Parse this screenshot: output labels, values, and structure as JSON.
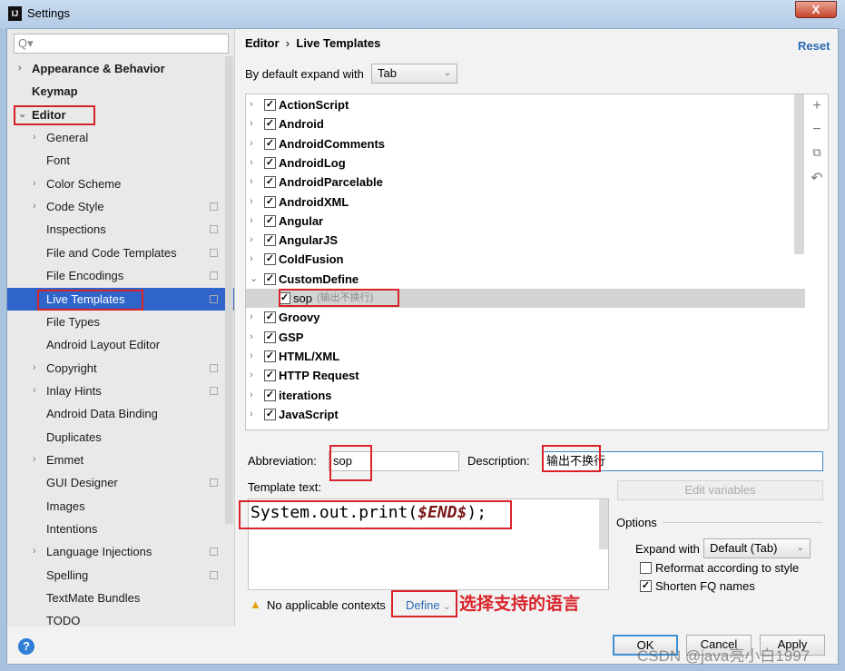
{
  "window": {
    "title": "Settings",
    "close_label": "X"
  },
  "sidebar": {
    "search_placeholder": "Q▾",
    "items": [
      {
        "label": "Appearance & Behavior",
        "level": 0,
        "arrow": true,
        "bold": true
      },
      {
        "label": "Keymap",
        "level": 0,
        "bold": true
      },
      {
        "label": "Editor",
        "level": 0,
        "arrow": "open",
        "bold": true
      },
      {
        "label": "General",
        "level": 1,
        "arrow": true
      },
      {
        "label": "Font",
        "level": 1
      },
      {
        "label": "Color Scheme",
        "level": 1,
        "arrow": true
      },
      {
        "label": "Code Style",
        "level": 1,
        "arrow": true,
        "copy": true
      },
      {
        "label": "Inspections",
        "level": 1,
        "copy": true
      },
      {
        "label": "File and Code Templates",
        "level": 1,
        "copy": true
      },
      {
        "label": "File Encodings",
        "level": 1,
        "copy": true
      },
      {
        "label": "Live Templates",
        "level": 1,
        "copy": true,
        "selected": true
      },
      {
        "label": "File Types",
        "level": 1
      },
      {
        "label": "Android Layout Editor",
        "level": 1
      },
      {
        "label": "Copyright",
        "level": 1,
        "arrow": true,
        "copy": true
      },
      {
        "label": "Inlay Hints",
        "level": 1,
        "arrow": true,
        "copy": true
      },
      {
        "label": "Android Data Binding",
        "level": 1
      },
      {
        "label": "Duplicates",
        "level": 1
      },
      {
        "label": "Emmet",
        "level": 1,
        "arrow": true
      },
      {
        "label": "GUI Designer",
        "level": 1,
        "copy": true
      },
      {
        "label": "Images",
        "level": 1
      },
      {
        "label": "Intentions",
        "level": 1
      },
      {
        "label": "Language Injections",
        "level": 1,
        "arrow": true,
        "copy": true
      },
      {
        "label": "Spelling",
        "level": 1,
        "copy": true
      },
      {
        "label": "TextMate Bundles",
        "level": 1
      },
      {
        "label": "TODO",
        "level": 1
      }
    ]
  },
  "header": {
    "crumb_parent": "Editor",
    "crumb_sep": "›",
    "crumb_current": "Live Templates",
    "reset": "Reset"
  },
  "expand": {
    "label": "By default expand with",
    "value": "Tab"
  },
  "tree": [
    {
      "label": "ActionScript"
    },
    {
      "label": "Android"
    },
    {
      "label": "AndroidComments"
    },
    {
      "label": "AndroidLog"
    },
    {
      "label": "AndroidParcelable"
    },
    {
      "label": "AndroidXML"
    },
    {
      "label": "Angular"
    },
    {
      "label": "AngularJS"
    },
    {
      "label": "ColdFusion"
    },
    {
      "label": "CustomDefine",
      "open": true
    },
    {
      "label": "sop",
      "desc": "(输出不换行)",
      "child": true,
      "selected": true
    },
    {
      "label": "Groovy"
    },
    {
      "label": "GSP"
    },
    {
      "label": "HTML/XML"
    },
    {
      "label": "HTTP Request"
    },
    {
      "label": "iterations"
    },
    {
      "label": "JavaScript"
    }
  ],
  "tools": [
    "+",
    "−",
    "⧉",
    "↶"
  ],
  "editor": {
    "abbreviation_label": "Abbreviation:",
    "abbreviation": "sop",
    "description_label": "Description:",
    "description": "输出不换行",
    "template_label": "Template text:",
    "template_pre": "System.out.print(",
    "template_var": "$END$",
    "template_post": ");",
    "edit_variables": "Edit variables",
    "options_label": "Options",
    "expand_with_label": "Expand with",
    "expand_with": "Default (Tab)",
    "reformat": "Reformat according to style",
    "reformat_checked": false,
    "shorten": "Shorten FQ names",
    "shorten_checked": true,
    "warning": "No applicable contexts",
    "define": "Define",
    "annotation": "选择支持的语言"
  },
  "buttons": {
    "ok": "OK",
    "cancel": "Cancel",
    "apply": "Apply"
  },
  "watermark": "CSDN @java亮小白1997",
  "colors": {
    "accent": "#2f65ca",
    "highlight": "#d8232a",
    "link": "#2a6ab3"
  }
}
